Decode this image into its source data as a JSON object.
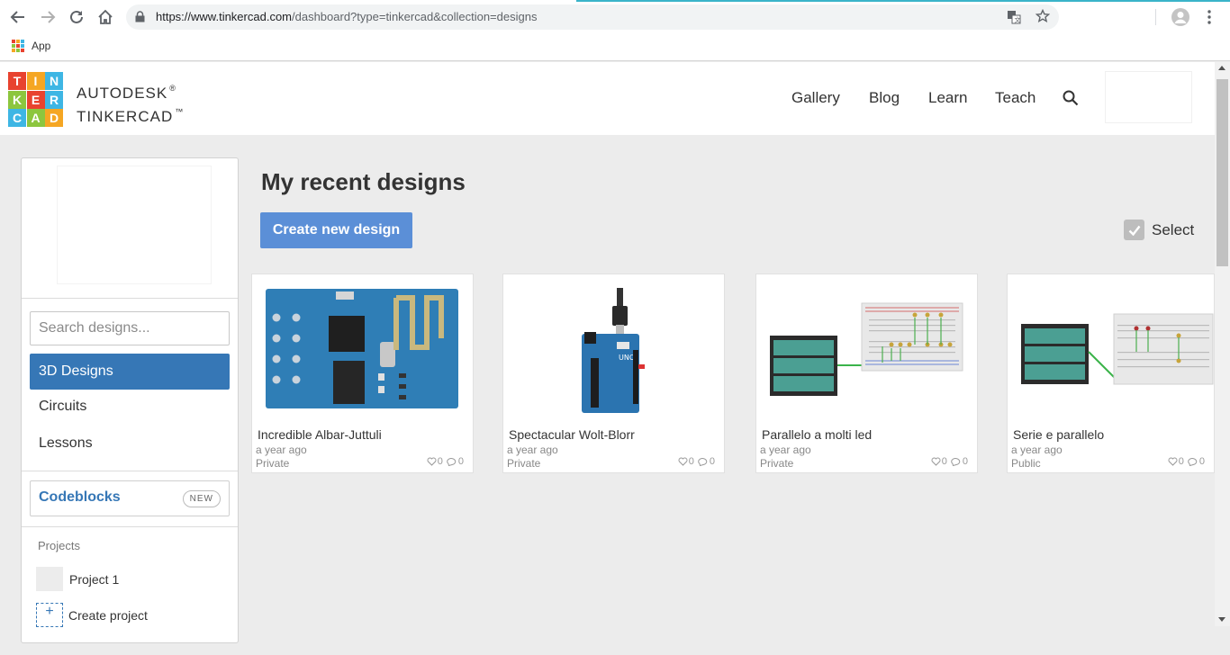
{
  "browser": {
    "url_host": "https://www.tinkercad.com",
    "url_path": "/dashboard?type=tinkercad&collection=designs",
    "bookmark_apps": "App"
  },
  "header": {
    "logo_letters": [
      "T",
      "I",
      "N",
      "K",
      "E",
      "R",
      "C",
      "A",
      "D"
    ],
    "brand_line1": "AUTODESK",
    "brand_line1_mark": "®",
    "brand_line2": "TINKERCAD",
    "brand_line2_mark": "™",
    "nav": [
      "Gallery",
      "Blog",
      "Learn",
      "Teach"
    ]
  },
  "sidebar": {
    "search_placeholder": "Search designs...",
    "items": [
      {
        "label": "3D Designs",
        "active": true
      },
      {
        "label": "Circuits",
        "active": false
      },
      {
        "label": "Lessons",
        "active": false
      }
    ],
    "codeblocks_label": "Codeblocks",
    "codeblocks_badge": "NEW",
    "projects_title": "Projects",
    "project_name": "Project 1",
    "create_project": "Create project",
    "create_project_symbol": "+"
  },
  "main": {
    "title": "My recent designs",
    "create_button": "Create new design",
    "select_label": "Select",
    "designs": [
      {
        "title": "Incredible Albar-Juttuli",
        "time": "a year ago",
        "visibility": "Private",
        "likes": "0",
        "comments": "0",
        "thumb": "esp8266-board"
      },
      {
        "title": "Spectacular Wolt-Blorr",
        "time": "a year ago",
        "visibility": "Private",
        "likes": "0",
        "comments": "0",
        "thumb": "arduino-board"
      },
      {
        "title": "Parallelo a molti led",
        "time": "a year ago",
        "visibility": "Private",
        "likes": "0",
        "comments": "0",
        "thumb": "battery-breadboard-leds"
      },
      {
        "title": "Serie e parallelo",
        "time": "a year ago",
        "visibility": "Public",
        "likes": "0",
        "comments": "0",
        "thumb": "battery-breadboard-series"
      }
    ]
  },
  "colors": {
    "accent": "#3677b6",
    "button": "#5b8fd7",
    "logo": [
      "#e8432f",
      "#f5a623",
      "#8cc63e",
      "#3eb6e4",
      "#e8432f",
      "#8cc63e",
      "#3eb6e4",
      "#f5a623",
      "#3677b6"
    ]
  }
}
